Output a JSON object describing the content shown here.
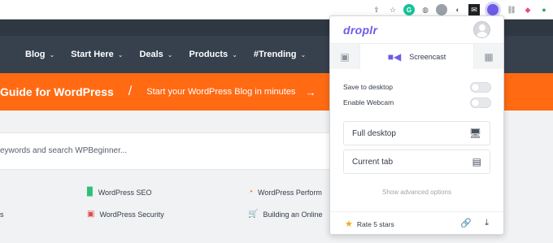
{
  "extensions": [
    {
      "name": "share-icon",
      "glyph": "⇪"
    },
    {
      "name": "bookmark-star-icon",
      "glyph": "☆"
    },
    {
      "name": "grammarly-extension-icon",
      "glyph": "G",
      "color": "#15c39a"
    },
    {
      "name": "globe-extension-icon",
      "glyph": "◍"
    },
    {
      "name": "extension-icon-1",
      "glyph": "✱"
    },
    {
      "name": "extension-icon-2",
      "glyph": "◐"
    },
    {
      "name": "extension-icon-3",
      "glyph": "✉"
    },
    {
      "name": "droplr-extension-icon",
      "glyph": ""
    },
    {
      "name": "link-extension-icon",
      "glyph": "🔗"
    },
    {
      "name": "colorful-extension-icon",
      "glyph": "◆"
    }
  ],
  "nav": {
    "items": [
      {
        "label": "Blog",
        "chev": "⌄"
      },
      {
        "label": "Start Here",
        "chev": "⌄"
      },
      {
        "label": "Deals",
        "chev": "⌄"
      },
      {
        "label": "Products",
        "chev": "⌄"
      },
      {
        "label": "#Trending",
        "chev": "⌄"
      }
    ]
  },
  "banner": {
    "title": "Guide for WordPress",
    "slash": "/",
    "subtitle": "Start your WordPress Blog in minutes",
    "arrow": "→"
  },
  "search": {
    "placeholder": "eywords and search WPBeginner..."
  },
  "links": {
    "left_edge": "s",
    "seo": "WordPress SEO",
    "security": "WordPress Security",
    "performance": "WordPress Perform",
    "online": "Building an Online"
  },
  "popup": {
    "logo": "droplr",
    "tab_active_label": "Screencast",
    "toggles": [
      {
        "label": "Save to desktop",
        "on": false
      },
      {
        "label": "Enable Webcam",
        "on": false
      }
    ],
    "capture_options": [
      {
        "label": "Full desktop",
        "icon": "monitor-icon"
      },
      {
        "label": "Current tab",
        "icon": "browser-tab-icon"
      }
    ],
    "advanced_label": "Show advanced options",
    "rate_label": "Rate 5 stars"
  },
  "colors": {
    "accent": "#6c5ce7",
    "orange": "#ff6a13",
    "nav_bg": "#37404d"
  }
}
